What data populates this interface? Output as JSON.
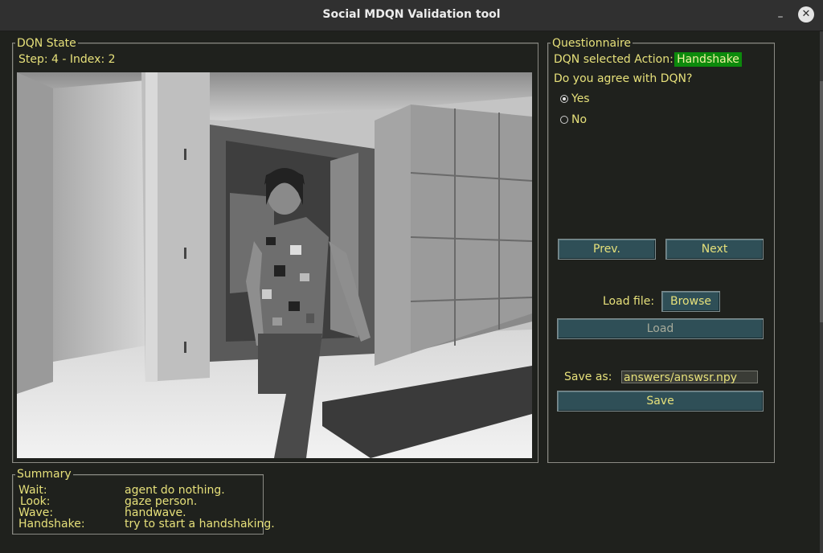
{
  "window": {
    "title": "Social MDQN Validation tool",
    "minimize_glyph": "–",
    "close_glyph": "✕"
  },
  "dqn_state": {
    "frame_label": "DQN State",
    "step_text": "Step: 4 - Index:  2",
    "image_semantic": "camera-view-person-walking-in-corridor"
  },
  "questionnaire": {
    "frame_label": "Questionnaire",
    "action_label": "DQN selected Action:",
    "action_value": "Handshake",
    "agree_question": "Do you agree with DQN?",
    "options": [
      {
        "label": "Yes",
        "selected": true
      },
      {
        "label": "No",
        "selected": false
      }
    ],
    "prev_label": "Prev.",
    "next_label": "Next",
    "load_file_label": "Load file:",
    "browse_label": "Browse",
    "load_label": "Load",
    "save_as_label": "Save as:",
    "save_as_value": "answers/answsr.npy",
    "save_label": "Save"
  },
  "summary": {
    "frame_label": "Summary",
    "rows": [
      {
        "key": "Wait:",
        "value": "agent do nothing."
      },
      {
        "key": "Look:",
        "value": "gaze person."
      },
      {
        "key": "Wave:",
        "value": "handwave."
      },
      {
        "key": "Handshake:",
        "value": "try to start a handshaking."
      }
    ]
  },
  "colors": {
    "text": "#e6e07a",
    "background": "#1f211d",
    "button": "#2f4f57",
    "badge": "#0c8a0c"
  }
}
